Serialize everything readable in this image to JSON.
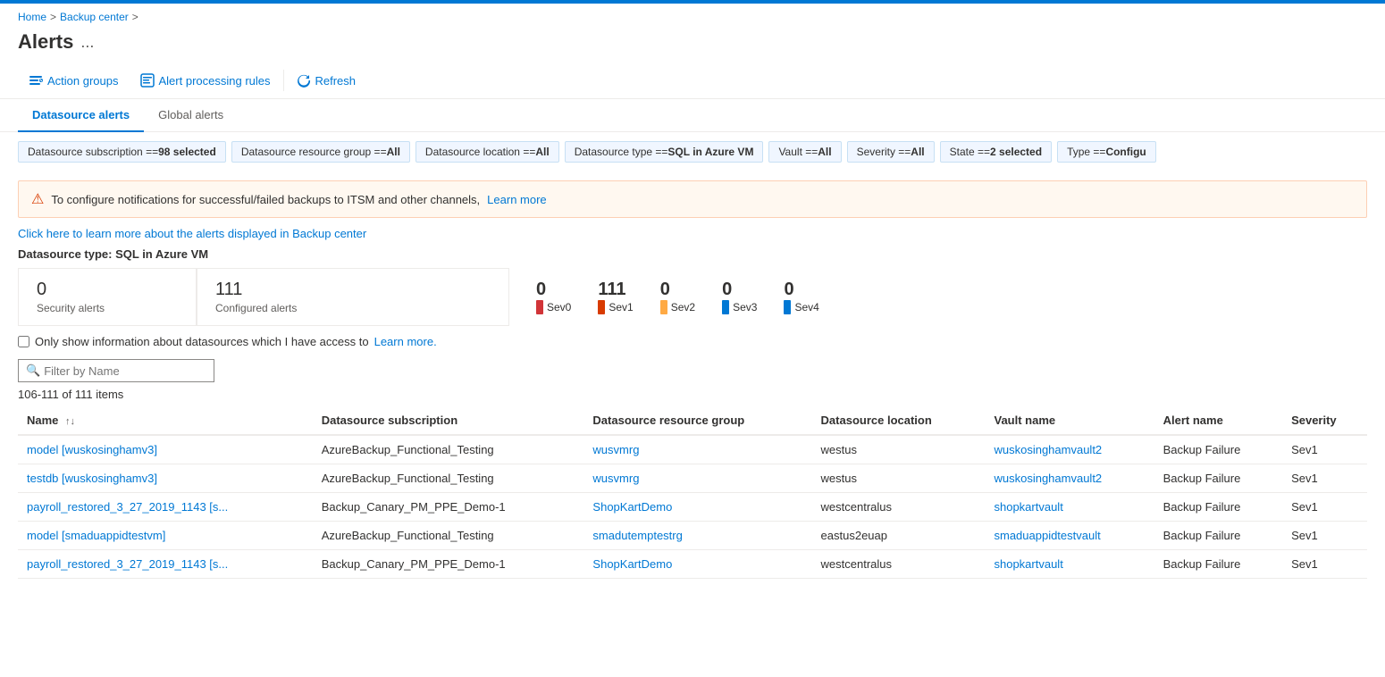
{
  "topbar": {
    "accent_color": "#0078d4"
  },
  "breadcrumb": {
    "home": "Home",
    "separator1": ">",
    "backupcenter": "Backup center",
    "separator2": ">"
  },
  "header": {
    "title": "Alerts",
    "ellipsis": "..."
  },
  "toolbar": {
    "action_groups_label": "Action groups",
    "alert_processing_rules_label": "Alert processing rules",
    "refresh_label": "Refresh"
  },
  "tabs": [
    {
      "id": "datasource",
      "label": "Datasource alerts",
      "active": true
    },
    {
      "id": "global",
      "label": "Global alerts",
      "active": false
    }
  ],
  "filters": [
    {
      "id": "subscription",
      "text": "Datasource subscription == ",
      "value": "98 selected"
    },
    {
      "id": "resource_group",
      "text": "Datasource resource group == ",
      "value": "All"
    },
    {
      "id": "location",
      "text": "Datasource location == ",
      "value": "All"
    },
    {
      "id": "type",
      "text": "Datasource type == ",
      "value": "SQL in Azure VM"
    },
    {
      "id": "vault",
      "text": "Vault == ",
      "value": "All"
    },
    {
      "id": "severity",
      "text": "Severity == ",
      "value": "All"
    },
    {
      "id": "state",
      "text": "State == ",
      "value": "2 selected"
    },
    {
      "id": "alert_type",
      "text": "Type == ",
      "value": "Configu"
    }
  ],
  "alert_banner": {
    "text": "To configure notifications for successful/failed backups to ITSM and other channels,",
    "learn_more": "Learn more"
  },
  "learn_link": {
    "text": "Click here to learn more about the alerts displayed in Backup center"
  },
  "datasource_type_label": "Datasource type: SQL in Azure VM",
  "stats": {
    "security_alerts_count": "0",
    "security_alerts_label": "Security alerts",
    "configured_alerts_count": "111",
    "configured_alerts_label": "Configured alerts",
    "severities": [
      {
        "id": "sev0",
        "count": "0",
        "label": "Sev0",
        "color": "#d13438"
      },
      {
        "id": "sev1",
        "count": "111",
        "label": "Sev1",
        "color": "#d83b01"
      },
      {
        "id": "sev2",
        "count": "0",
        "label": "Sev2",
        "color": "#ffaa44"
      },
      {
        "id": "sev3",
        "count": "0",
        "label": "Sev3",
        "color": "#0078d4"
      },
      {
        "id": "sev4",
        "count": "0",
        "label": "Sev4",
        "color": "#0078d4"
      }
    ]
  },
  "checkbox_row": {
    "label": "Only show information about datasources which I have access to",
    "learn_more_text": "Learn more."
  },
  "search": {
    "placeholder": "Filter by Name"
  },
  "items_count": "106-111 of 111 items",
  "table": {
    "columns": [
      {
        "id": "name",
        "label": "Name",
        "sortable": true
      },
      {
        "id": "subscription",
        "label": "Datasource subscription",
        "sortable": false
      },
      {
        "id": "resource_group",
        "label": "Datasource resource group",
        "sortable": false
      },
      {
        "id": "location",
        "label": "Datasource location",
        "sortable": false
      },
      {
        "id": "vault_name",
        "label": "Vault name",
        "sortable": false
      },
      {
        "id": "alert_name",
        "label": "Alert name",
        "sortable": false
      },
      {
        "id": "severity",
        "label": "Severity",
        "sortable": false
      }
    ],
    "rows": [
      {
        "name": "model [wuskosinghamv3]",
        "subscription": "AzureBackup_Functional_Testing",
        "resource_group": "wusvmrg",
        "location": "westus",
        "vault_name": "wuskosinghamvault2",
        "alert_name": "Backup Failure",
        "severity": "Sev1"
      },
      {
        "name": "testdb [wuskosinghamv3]",
        "subscription": "AzureBackup_Functional_Testing",
        "resource_group": "wusvmrg",
        "location": "westus",
        "vault_name": "wuskosinghamvault2",
        "alert_name": "Backup Failure",
        "severity": "Sev1"
      },
      {
        "name": "payroll_restored_3_27_2019_1143 [s...",
        "subscription": "Backup_Canary_PM_PPE_Demo-1",
        "resource_group": "ShopKartDemo",
        "location": "westcentralus",
        "vault_name": "shopkartvault",
        "alert_name": "Backup Failure",
        "severity": "Sev1"
      },
      {
        "name": "model [smaduappidtestvm]",
        "subscription": "AzureBackup_Functional_Testing",
        "resource_group": "smadutemptestrg",
        "location": "eastus2euap",
        "vault_name": "smaduappidtestvault",
        "alert_name": "Backup Failure",
        "severity": "Sev1"
      },
      {
        "name": "payroll_restored_3_27_2019_1143 [s...",
        "subscription": "Backup_Canary_PM_PPE_Demo-1",
        "resource_group": "ShopKartDemo",
        "location": "westcentralus",
        "vault_name": "shopkartvault",
        "alert_name": "Backup Failure",
        "severity": "Sev1"
      }
    ]
  }
}
